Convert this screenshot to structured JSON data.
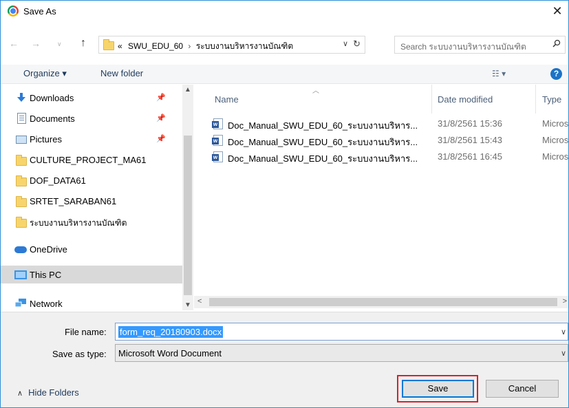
{
  "window": {
    "title": "Save As"
  },
  "address": {
    "prefix": "«",
    "segments": [
      "SWU_EDU_60",
      "ระบบงานบริหารงานบัณฑิต"
    ],
    "separator": "›",
    "search_placeholder": "Search ระบบงานบริหารงานบัณฑิต"
  },
  "toolbar": {
    "organize": "Organize ▾",
    "new_folder": "New folder",
    "view": "☷ ▾",
    "help": "?"
  },
  "nav": {
    "items": [
      {
        "label": "Downloads",
        "icon": "download-icon"
      },
      {
        "label": "Documents",
        "icon": "documents-icon"
      },
      {
        "label": "Pictures",
        "icon": "pictures-icon"
      },
      {
        "label": "CULTURE_PROJECT_MA61",
        "icon": "folder-icon"
      },
      {
        "label": "DOF_DATA61",
        "icon": "folder-icon"
      },
      {
        "label": "SRTET_SARABAN61",
        "icon": "folder-icon"
      },
      {
        "label": "ระบบงานบริหารงานบัณฑิต",
        "icon": "folder-icon"
      },
      {
        "label": "OneDrive",
        "icon": "onedrive-icon"
      },
      {
        "label": "This PC",
        "icon": "this-pc-icon",
        "selected": true
      },
      {
        "label": "Network",
        "icon": "network-icon"
      }
    ]
  },
  "files": {
    "columns": {
      "name": "Name",
      "date": "Date modified",
      "type": "Type"
    },
    "rows": [
      {
        "name": "Doc_Manual_SWU_EDU_60_ระบบงานบริหาร...",
        "date": "31/8/2561 15:36",
        "type": "Micros"
      },
      {
        "name": "Doc_Manual_SWU_EDU_60_ระบบงานบริหาร...",
        "date": "31/8/2561 15:43",
        "type": "Micros"
      },
      {
        "name": "Doc_Manual_SWU_EDU_60_ระบบงานบริหาร...",
        "date": "31/8/2561 16:45",
        "type": "Micros"
      }
    ]
  },
  "form": {
    "file_name_label": "File name:",
    "file_name_value": "form_req_20180903.docx",
    "save_as_type_label": "Save as type:",
    "save_as_type_value": "Microsoft Word Document"
  },
  "footer": {
    "hide_folders": "Hide Folders",
    "save": "Save",
    "cancel": "Cancel"
  },
  "colors": {
    "accent": "#0078d7",
    "highlight": "#d8202c",
    "selection": "#3399ff"
  }
}
